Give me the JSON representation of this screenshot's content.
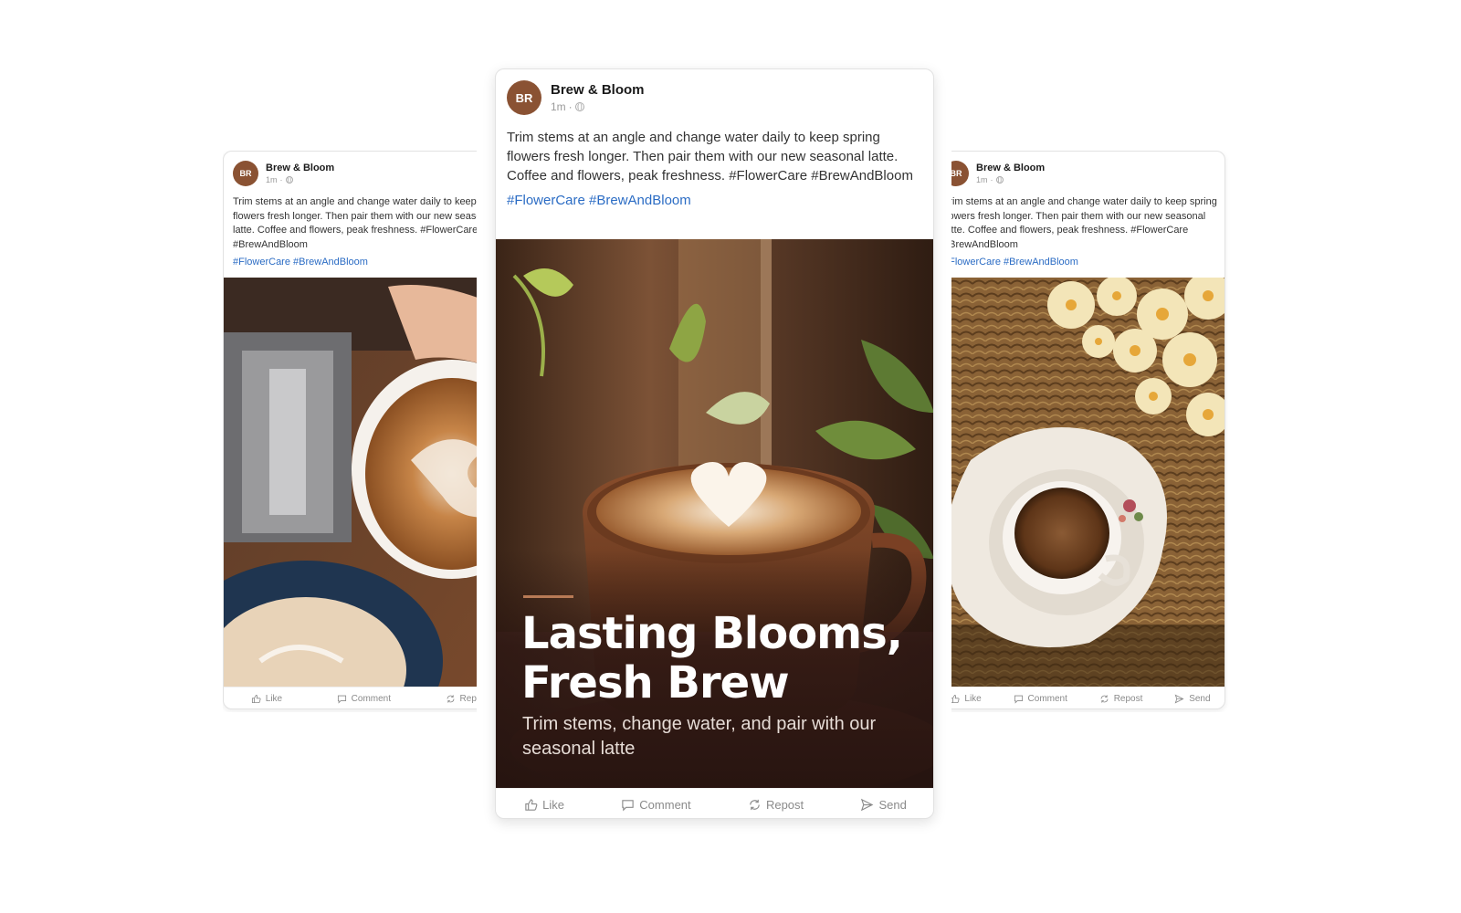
{
  "brand": {
    "name": "Brew & Bloom",
    "initials": "BR",
    "avatar_color": "#8a5233",
    "timestamp": "1m",
    "dot": "·",
    "visibility_icon": "globe-icon"
  },
  "post": {
    "text": "Trim stems at an angle and change water daily to keep spring flowers fresh longer. Then pair them with our new seasonal latte. Coffee and flowers, peak freshness. #FlowerCare #BrewAndBloom",
    "hashtags": "#FlowerCare #BrewAndBloom",
    "hashtag_color": "#2b6cc4"
  },
  "cards": {
    "left": {
      "image": "latte art being poured"
    },
    "center": {
      "image": "latte with heart art beside plants",
      "headline": "Lasting Blooms, Fresh Brew",
      "subline": "Trim stems, change water, and pair with our seasonal latte"
    },
    "right": {
      "image": "espresso cup on saucer with yellow flowers"
    }
  },
  "actions": {
    "like": "Like",
    "comment": "Comment",
    "repost": "Repost",
    "send": "Send"
  }
}
